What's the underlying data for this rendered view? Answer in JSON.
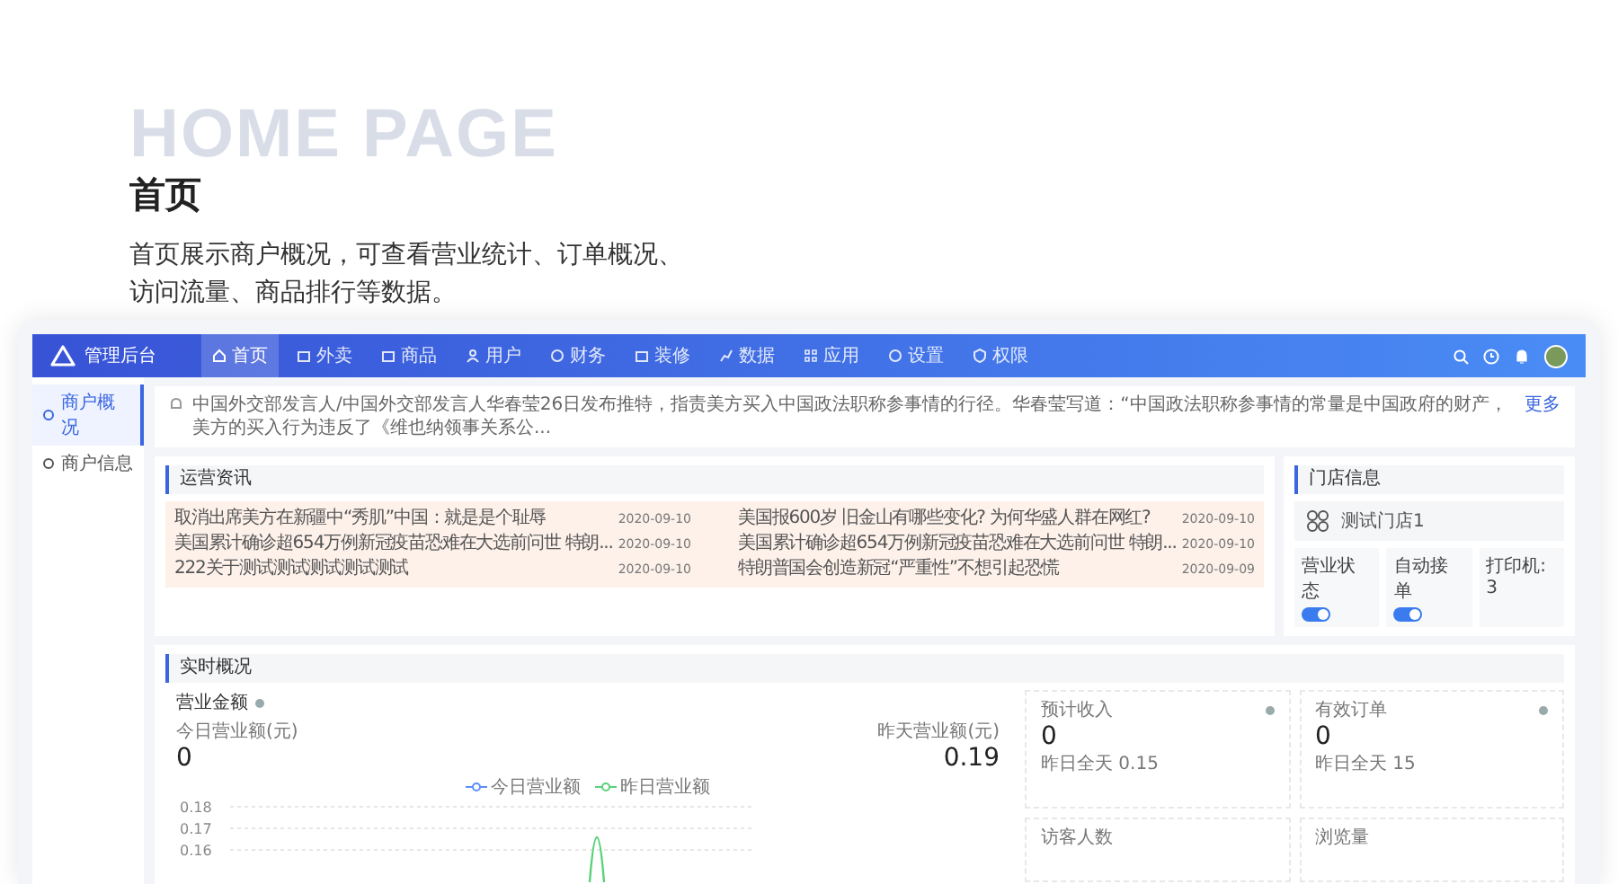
{
  "hero": {
    "watermark": "HOME PAGE",
    "title": "首页",
    "description_lines": [
      "首页展示商户概况，可查看营业统计、订单概况、",
      "访问流量、商品排行等数据。"
    ]
  },
  "app": {
    "logo": "管理后台",
    "nav": [
      {
        "label": "首页",
        "selected": true
      },
      {
        "label": "外卖",
        "selected": false
      },
      {
        "label": "商品",
        "selected": false
      },
      {
        "label": "用户",
        "selected": false
      },
      {
        "label": "财务",
        "selected": false
      },
      {
        "label": "装修",
        "selected": false
      },
      {
        "label": "数据",
        "selected": false
      },
      {
        "label": "应用",
        "selected": false
      },
      {
        "label": "设置",
        "selected": false
      },
      {
        "label": "权限",
        "selected": false
      }
    ],
    "sidebar": [
      {
        "label": "商户概况",
        "selected": true
      },
      {
        "label": "商户信息",
        "selected": false
      }
    ],
    "notice": {
      "text": "中国外交部发言人/中国外交部发言人华春莹26日发布推特，指责美方买入中国政法职称参事情的行径。华春莹写道：“中国政法职称参事情的常量是中国政府的财产，美方的买入行为违反了《维也纳领事关系公...",
      "more": "更多"
    },
    "news": {
      "title": "运营资讯",
      "items": [
        {
          "title": "取消出席美方在新疆中“秀肌”中国：就是是个耻辱",
          "date": "2020-09-10"
        },
        {
          "title": "美国报600岁 旧金山有哪些变化? 为何华盛人群在网红?",
          "date": "2020-09-10"
        },
        {
          "title": "美国累计确诊超654万例新冠疫苗恐难在大选前问世 特朗...",
          "date": "2020-09-10"
        },
        {
          "title": "美国累计确诊超654万例新冠疫苗恐难在大选前问世 特朗...",
          "date": "2020-09-10"
        },
        {
          "title": "222关于测试测试测试测试测试",
          "date": "2020-09-10"
        },
        {
          "title": "特朗普国会创造新冠“严重性”不想引起恐慌",
          "date": "2020-09-09"
        }
      ]
    },
    "store": {
      "title": "门店信息",
      "name": "测试门店1",
      "settings": [
        {
          "kind": "toggle",
          "label": "营业状态",
          "on": true
        },
        {
          "kind": "toggle",
          "label": "自动接单",
          "on": true
        },
        {
          "kind": "text",
          "label": "打印机: 3"
        }
      ]
    },
    "realtime": {
      "title": "实时概况",
      "revenue_title": "营业金额",
      "today_label": "今日营业额(元)",
      "today_value": "0",
      "yesterday_label": "昨天营业额(元)",
      "yesterday_value": "0.19",
      "legend": [
        {
          "label": "今日营业额",
          "color": "#5b8ff9"
        },
        {
          "label": "昨日营业额",
          "color": "#5ad17a"
        }
      ],
      "axis_labels": [
        "0.18",
        "0.17",
        "0.16"
      ],
      "cards": [
        {
          "label": "预计收入",
          "value": "0",
          "note": "昨日全天 0.15"
        },
        {
          "label": "有效订单",
          "value": "0",
          "note": "昨日全天 15"
        },
        {
          "label": "访客人数"
        },
        {
          "label": "浏览量"
        }
      ]
    }
  }
}
